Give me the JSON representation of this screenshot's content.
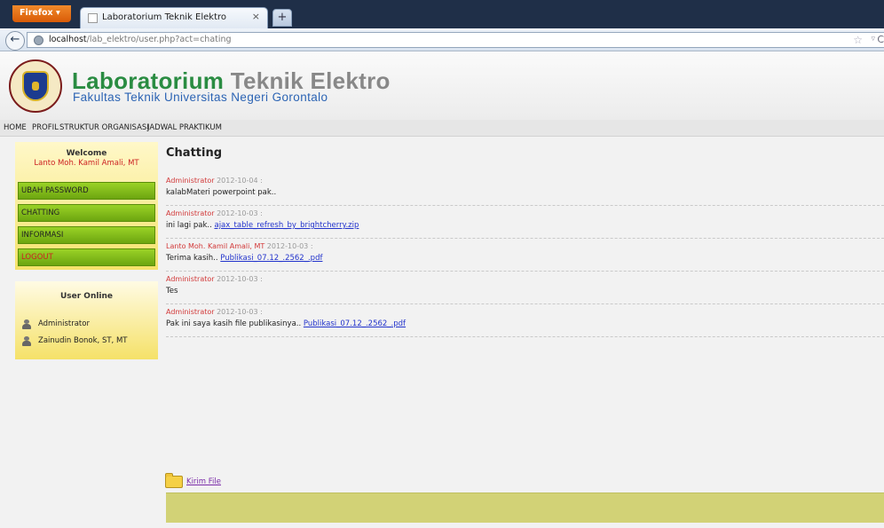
{
  "browser": {
    "app_button": "Firefox",
    "tab_title": "Laboratorium Teknik Elektro",
    "tab_close": "×",
    "new_tab": "+",
    "url_host": "localhost",
    "url_path": "/lab_elektro/user.php?act=chating",
    "back": "←",
    "star": "☆",
    "dropdown": "▿",
    "reload": "C"
  },
  "header": {
    "title_highlight": "Laboratorium",
    "title_rest": " Teknik Elektro",
    "subtitle": "Fakultas Teknik Universitas Negeri Gorontalo"
  },
  "menu": {
    "items": [
      "HOME",
      "PROFIL",
      "STRUKTUR ORGANISASI",
      "JADWAL PRAKTIKUM"
    ]
  },
  "sidebar": {
    "welcome_title": "Welcome",
    "welcome_name": "Lanto Moh. Kamil Amali, MT",
    "items": [
      "UBAH PASSWORD",
      "CHATTING",
      "INFORMASI",
      "LOGOUT"
    ],
    "online_title": "User Online",
    "online_users": [
      "Administrator",
      "Zainudin Bonok, ST, MT"
    ]
  },
  "main": {
    "title": "Chatting",
    "messages": [
      {
        "author": "Administrator",
        "date": " 2012-10-04 :",
        "text": "kalabMateri powerpoint pak..",
        "link": ""
      },
      {
        "author": "Administrator",
        "date": " 2012-10-03 :",
        "text": "ini lagi pak.. ",
        "link": "ajax_table_refresh_by_brightcherry.zip"
      },
      {
        "author": "Lanto Moh. Kamil Amali, MT",
        "date": " 2012-10-03 :",
        "text": "Terima kasih.. ",
        "link": "Publikasi_07.12_.2562_.pdf"
      },
      {
        "author": "Administrator",
        "date": " 2012-10-03 :",
        "text": "Tes",
        "link": ""
      },
      {
        "author": "Administrator",
        "date": " 2012-10-03 :",
        "text": "Pak ini saya kasih file publikasinya.. ",
        "link": "Publikasi_07.12_.2562_.pdf"
      }
    ],
    "send_file": "Kirim File"
  }
}
